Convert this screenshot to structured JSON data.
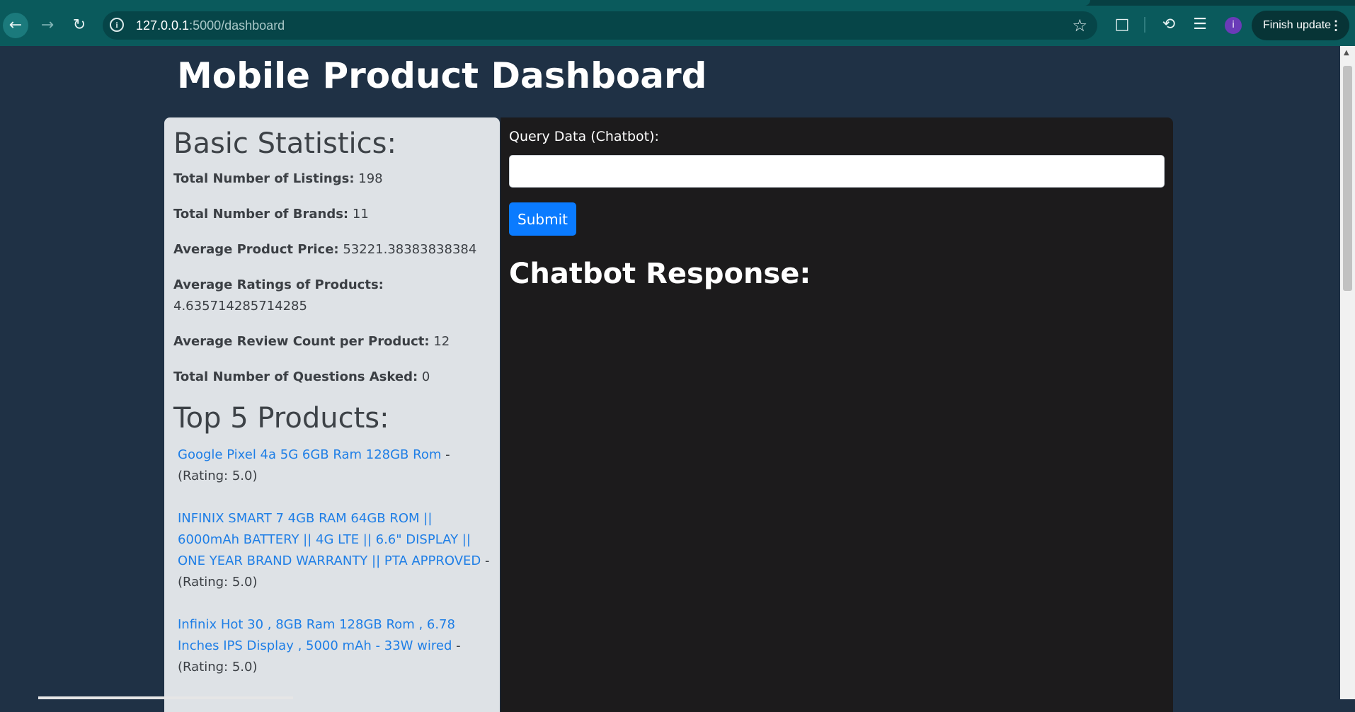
{
  "browser": {
    "url_host": "127.0.0.1",
    "url_path": ":5000/dashboard",
    "finish_update_label": "Finish update",
    "avatar_letter": "i",
    "icons": [
      "back-icon",
      "forward-icon",
      "reload-icon",
      "info-icon",
      "star-icon",
      "extensions-icon",
      "performance-icon",
      "media-icon",
      "menu-icon"
    ]
  },
  "page": {
    "title": "Mobile Product Dashboard"
  },
  "stats": {
    "heading": "Basic Statistics:",
    "items": [
      {
        "label": "Total Number of Listings:",
        "value": "198"
      },
      {
        "label": "Total Number of Brands:",
        "value": "11"
      },
      {
        "label": "Average Product Price:",
        "value": "53221.38383838384"
      },
      {
        "label": "Average Ratings of Products:",
        "value": "4.635714285714285"
      },
      {
        "label": "Average Review Count per Product:",
        "value": "12"
      },
      {
        "label": "Total Number of Questions Asked:",
        "value": "0"
      }
    ]
  },
  "top_products": {
    "heading": "Top 5 Products:",
    "items": [
      {
        "name": "Google Pixel 4a 5G 6GB Ram 128GB Rom",
        "rating_text": "- (Rating: 5.0)"
      },
      {
        "name": "INFINIX SMART 7 4GB RAM 64GB ROM || 6000mAh BATTERY || 4G LTE || 6.6\" DISPLAY || ONE YEAR BRAND WARRANTY || PTA APPROVED",
        "rating_text": "- (Rating: 5.0)"
      },
      {
        "name": "Infinix Hot 30 , 8GB Ram 128GB Rom , 6.78 Inches IPS Display , 5000 mAh - 33W wired",
        "rating_text": "- (Rating: 5.0)"
      }
    ]
  },
  "chat": {
    "query_label": "Query Data (Chatbot):",
    "query_value": "",
    "submit_label": "Submit",
    "response_heading": "Chatbot Response:"
  }
}
